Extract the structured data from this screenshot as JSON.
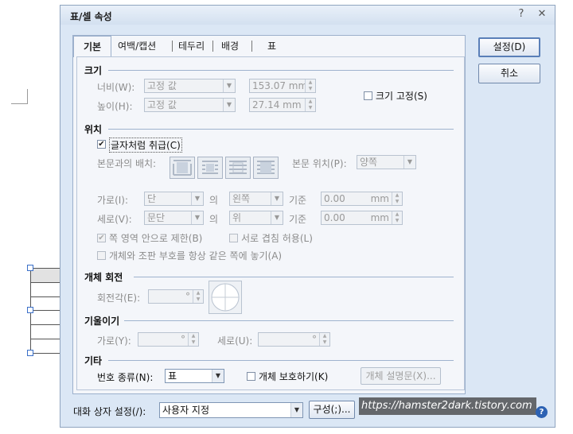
{
  "dialog": {
    "title": "표/셀 속성",
    "help_glyph": "?",
    "close_glyph": "✕",
    "tabs": [
      {
        "label": "기본"
      },
      {
        "label": "여백/캡션"
      },
      {
        "label": "테두리"
      },
      {
        "label": "배경"
      },
      {
        "label": "표"
      }
    ]
  },
  "size": {
    "heading": "크기",
    "width_label": "너비(W):",
    "width_mode": "고정 값",
    "width_value": "153.07 mm",
    "height_label": "높이(H):",
    "height_mode": "고정 값",
    "height_value": "27.14 mm",
    "fix_size_label": "크기 고정(S)"
  },
  "position": {
    "heading": "위치",
    "treat_as_char_label": "글자처럼 취급(C)",
    "treat_as_char_checked": "✔",
    "body_placement_label": "본문과의 배치:",
    "body_position_label": "본문 위치(P):",
    "body_position_value": "양쪽",
    "horiz_label": "가로(I):",
    "horiz_ref": "단",
    "horiz_of": "의",
    "horiz_align": "왼쪽",
    "horiz_base": "기준",
    "horiz_value": "0.00",
    "horiz_unit": "mm",
    "vert_label": "세로(V):",
    "vert_ref": "문단",
    "vert_of": "의",
    "vert_align": "위",
    "vert_base": "기준",
    "vert_value": "0.00",
    "vert_unit": "mm",
    "limit_label": "쪽 영역 안으로 제한(B)",
    "limit_checked": "✔",
    "overlap_label": "서로 겹침 허용(L)",
    "keep_same_page_label": "개체와 조판 부호를 항상 같은 쪽에 놓기(A)"
  },
  "rotation": {
    "heading": "개체 회전",
    "angle_label": "회전각(E):",
    "angle_unit": "°"
  },
  "skew": {
    "heading": "기울이기",
    "horiz_label": "가로(Y):",
    "horiz_unit": "°",
    "vert_label": "세로(U):",
    "vert_unit": "°"
  },
  "misc": {
    "heading": "기타",
    "number_type_label": "번호 종류(N):",
    "number_type_value": "표",
    "protect_label": "개체 보호하기(K)",
    "description_button": "개체 설명문(X)..."
  },
  "footer": {
    "dialog_setting_label": "대화 상자 설정(/):",
    "dialog_setting_value": "사용자 지정",
    "config_button": "구성(;)..."
  },
  "buttons": {
    "ok": "설정(D)",
    "cancel": "취소"
  },
  "watermark": "https://hamster2dark.tistory.com",
  "help_icon_glyph": "?"
}
